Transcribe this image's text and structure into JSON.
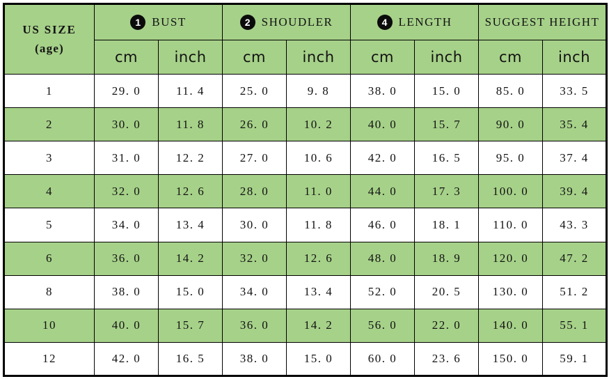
{
  "table": {
    "size_header": {
      "line1": "US SIZE",
      "line2": "(age)"
    },
    "groups": [
      {
        "badge": "1",
        "label": "BUST"
      },
      {
        "badge": "2",
        "label": "SHOUDLER"
      },
      {
        "badge": "4",
        "label": "LENGTH"
      },
      {
        "badge": "",
        "label": "SUGGEST HEIGHT"
      }
    ],
    "units": [
      "cm",
      "inch",
      "cm",
      "inch",
      "cm",
      "inch",
      "cm",
      "inch"
    ],
    "rows": [
      {
        "size": "1",
        "alt": false,
        "values": [
          "29. 0",
          "11. 4",
          "25. 0",
          "9. 8",
          "38. 0",
          "15. 0",
          "85. 0",
          "33. 5"
        ]
      },
      {
        "size": "2",
        "alt": true,
        "values": [
          "30. 0",
          "11. 8",
          "26. 0",
          "10. 2",
          "40. 0",
          "15. 7",
          "90. 0",
          "35. 4"
        ]
      },
      {
        "size": "3",
        "alt": false,
        "values": [
          "31. 0",
          "12. 2",
          "27. 0",
          "10. 6",
          "42. 0",
          "16. 5",
          "95. 0",
          "37. 4"
        ]
      },
      {
        "size": "4",
        "alt": true,
        "values": [
          "32. 0",
          "12. 6",
          "28. 0",
          "11. 0",
          "44. 0",
          "17. 3",
          "100. 0",
          "39. 4"
        ]
      },
      {
        "size": "5",
        "alt": false,
        "values": [
          "34. 0",
          "13. 4",
          "30. 0",
          "11. 8",
          "46. 0",
          "18. 1",
          "110. 0",
          "43. 3"
        ]
      },
      {
        "size": "6",
        "alt": true,
        "values": [
          "36. 0",
          "14. 2",
          "32. 0",
          "12. 6",
          "48. 0",
          "18. 9",
          "120. 0",
          "47. 2"
        ]
      },
      {
        "size": "8",
        "alt": false,
        "values": [
          "38. 0",
          "15. 0",
          "34. 0",
          "13. 4",
          "52. 0",
          "20. 5",
          "130. 0",
          "51. 2"
        ]
      },
      {
        "size": "10",
        "alt": true,
        "values": [
          "40. 0",
          "15. 7",
          "36. 0",
          "14. 2",
          "56. 0",
          "22. 0",
          "140. 0",
          "55. 1"
        ]
      },
      {
        "size": "12",
        "alt": false,
        "values": [
          "42. 0",
          "16. 5",
          "38. 0",
          "15. 0",
          "60. 0",
          "23. 6",
          "150. 0",
          "59. 1"
        ]
      }
    ]
  },
  "colors": {
    "header_green": "#a6d189",
    "row_green": "#a6d189",
    "row_white": "#ffffff",
    "border": "#000000",
    "badge_fill": "#0b0b0b",
    "badge_text": "#ffffff",
    "text": "#121212"
  }
}
